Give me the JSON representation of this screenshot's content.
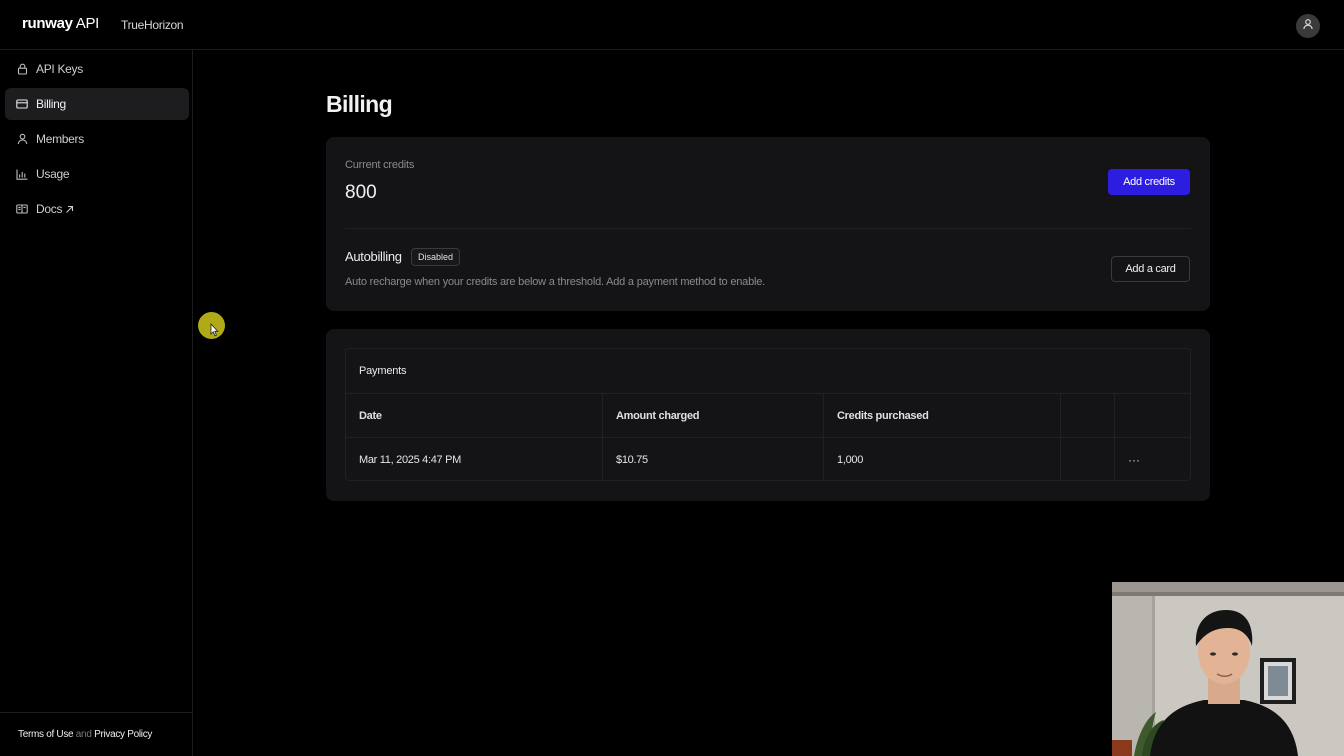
{
  "header": {
    "brand_bold": "runway",
    "brand_light": "API",
    "org_name": "TrueHorizon",
    "avatar_icon": "user-icon"
  },
  "sidebar": {
    "items": [
      {
        "label": "API Keys",
        "icon": "lock-icon",
        "active": false
      },
      {
        "label": "Billing",
        "icon": "credit-card-icon",
        "active": true
      },
      {
        "label": "Members",
        "icon": "user-icon",
        "active": false
      },
      {
        "label": "Usage",
        "icon": "bar-chart-icon",
        "active": false
      },
      {
        "label": "Docs",
        "icon": "book-icon",
        "active": false,
        "external": true
      }
    ],
    "footer": {
      "terms": "Terms of Use",
      "and": "and",
      "privacy": "Privacy Policy"
    }
  },
  "main": {
    "title": "Billing",
    "credits": {
      "label": "Current credits",
      "value": "800",
      "button": "Add credits"
    },
    "autobilling": {
      "title": "Autobilling",
      "status": "Disabled",
      "description": "Auto recharge when your credits are below a threshold. Add a payment method to enable.",
      "button": "Add a card"
    },
    "payments": {
      "title": "Payments",
      "columns": [
        "Date",
        "Amount charged",
        "Credits purchased",
        "",
        ""
      ],
      "rows": [
        {
          "date": "Mar 11, 2025 4:47 PM",
          "amount": "$10.75",
          "credits": "1,000",
          "actions": "···"
        }
      ]
    }
  },
  "colors": {
    "accent": "#2d1de0",
    "background": "#000000",
    "card": "#141416",
    "cursor_highlight": "#b9b31a"
  }
}
